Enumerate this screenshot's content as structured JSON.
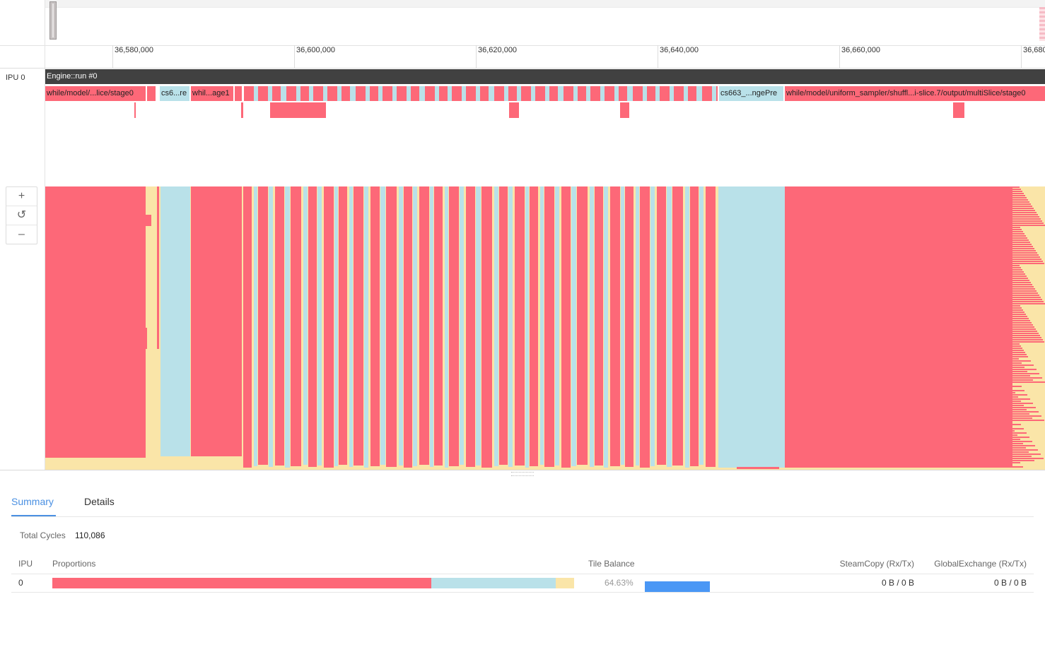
{
  "colors": {
    "compute": "#fd6878",
    "sync": "#b9e1e9",
    "idle": "#fae5a8",
    "engine": "#414141",
    "accent": "#4a90e2",
    "balance": "#4a97f5"
  },
  "ruler": {
    "ticks": [
      "36,580,000",
      "36,600,000",
      "36,620,000",
      "36,640,000",
      "36,660,000",
      "36,680"
    ]
  },
  "track": {
    "ipu_label": "IPU 0",
    "engine_label": "Engine::run #0",
    "stages": {
      "s1": "while/model/...lice/stage0",
      "s2": "cs6...re",
      "s3": "whil...age1",
      "s4": "cs663_...ngePre",
      "s5": "while/model/uniform_sampler/shuffl...i-slice.7/output/multiSlice/stage0"
    }
  },
  "zoom": {
    "zoom_in": "+",
    "reset": "↺",
    "zoom_out": "–"
  },
  "tabs": {
    "summary": "Summary",
    "details": "Details"
  },
  "summary": {
    "total_cycles_label": "Total Cycles",
    "total_cycles_value": "110,086"
  },
  "table": {
    "headers": {
      "ipu": "IPU",
      "proportions": "Proportions",
      "tile_balance": "Tile Balance",
      "steamcopy": "SteamCopy (Rx/Tx)",
      "globalexchange": "GlobalExchange (Rx/Tx)"
    },
    "row": {
      "ipu": "0",
      "proportions": {
        "compute": 0.726,
        "sync": 0.239,
        "idle": 0.035
      },
      "tile_balance": "64.63%",
      "tile_balance_fraction": 0.6463,
      "steamcopy": "0 B / 0 B",
      "globalexchange": "0 B / 0 B"
    }
  }
}
